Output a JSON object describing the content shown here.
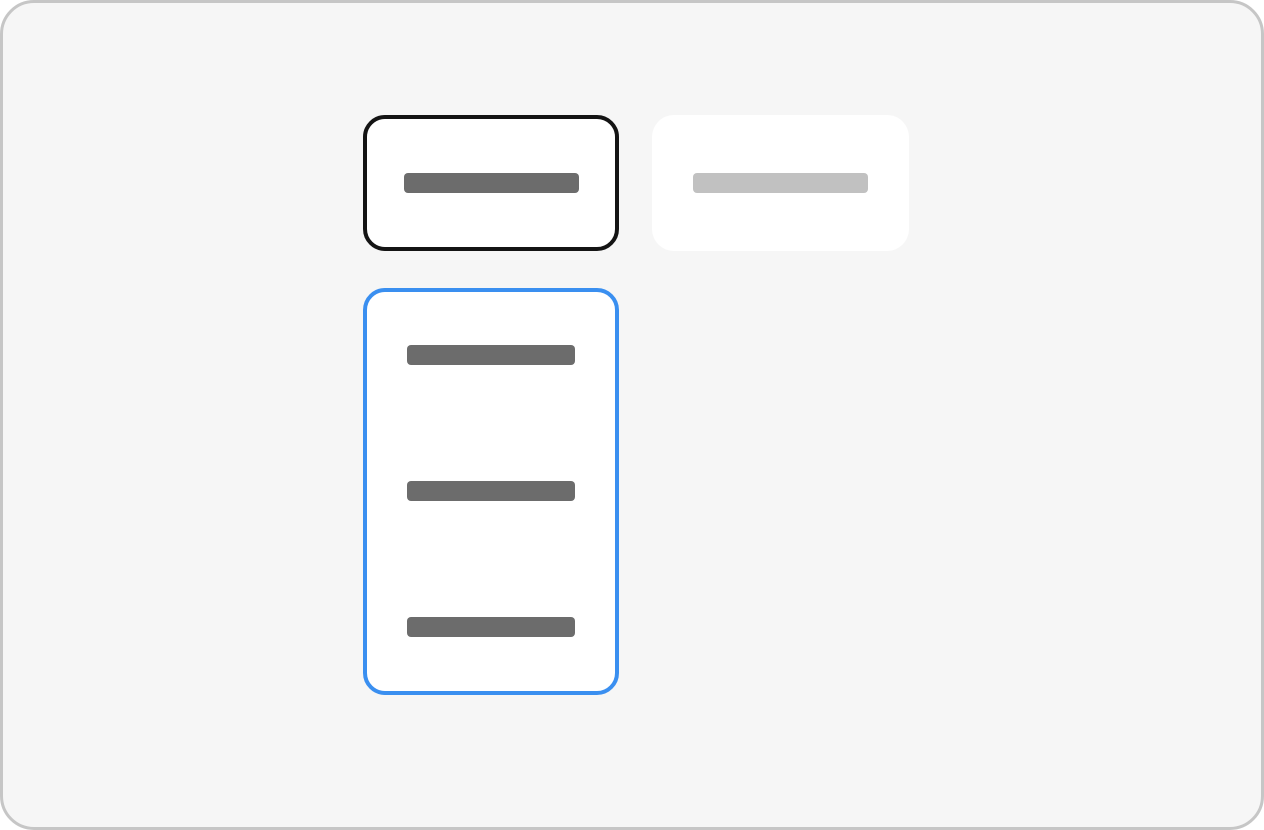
{
  "screen": {
    "options": [
      {
        "id": "option-1",
        "state": "selected",
        "label": ""
      },
      {
        "id": "option-2",
        "state": "disabled",
        "label": ""
      }
    ],
    "dropdown": {
      "state": "open",
      "items": [
        {
          "label": ""
        },
        {
          "label": ""
        },
        {
          "label": ""
        }
      ]
    }
  },
  "colors": {
    "background": "#f6f6f6",
    "frame_border": "#c6c6c6",
    "selected_border": "#141414",
    "focus_border": "#3a8ff0",
    "text_placeholder": "#6c6c6c",
    "text_placeholder_disabled": "#c1c1c1"
  }
}
